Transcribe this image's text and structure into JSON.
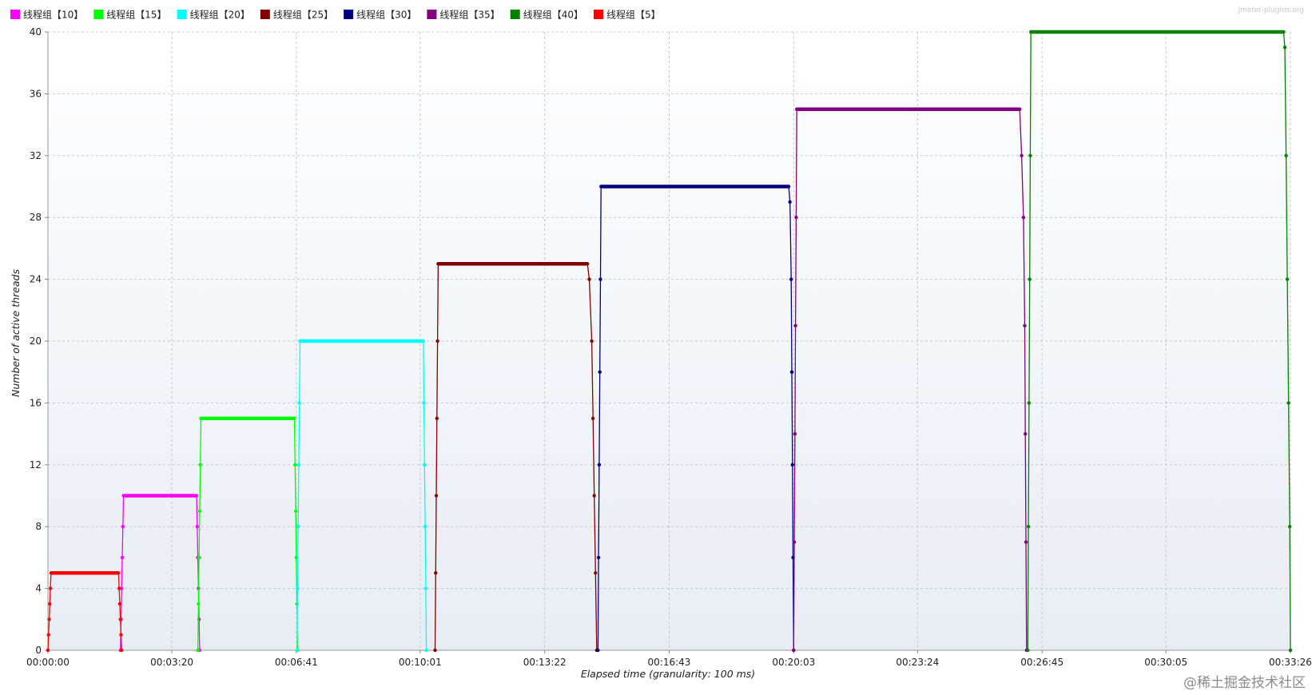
{
  "brand_text": "jmeter-plugins.org",
  "watermark": "@稀土掘金技术社区",
  "chart_data": {
    "type": "line",
    "title": "",
    "xlabel": "Elapsed time (granularity: 100 ms)",
    "ylabel": "Number of active threads",
    "x_unit": "seconds",
    "xlim": [
      0,
      2006
    ],
    "ylim": [
      0,
      40
    ],
    "grid": true,
    "legend_position": "top-left",
    "y_ticks": [
      0,
      4,
      8,
      12,
      16,
      20,
      24,
      28,
      32,
      36,
      40
    ],
    "x_ticks": [
      0,
      200,
      401,
      601,
      802,
      1003,
      1204,
      1404,
      1605,
      1805,
      2006
    ],
    "x_tick_labels": [
      "00:00:00",
      "00:03:20",
      "00:06:41",
      "00:10:01",
      "00:13:22",
      "00:16:43",
      "00:20:03",
      "00:23:24",
      "00:26:45",
      "00:30:05",
      "00:33:26"
    ],
    "series": [
      {
        "name": "线程组【10】",
        "color": "#ff00ff",
        "points": [
          [
            117,
            0
          ],
          [
            118,
            2
          ],
          [
            119,
            4
          ],
          [
            120,
            6
          ],
          [
            121,
            8
          ],
          [
            122,
            10
          ],
          [
            240,
            10
          ],
          [
            241,
            8
          ],
          [
            242,
            6
          ],
          [
            243,
            4
          ],
          [
            244,
            2
          ],
          [
            245,
            0
          ]
        ]
      },
      {
        "name": "线程组【15】",
        "color": "#00ff00",
        "points": [
          [
            242,
            0
          ],
          [
            243,
            3
          ],
          [
            244,
            6
          ],
          [
            245,
            9
          ],
          [
            246,
            12
          ],
          [
            247,
            15
          ],
          [
            398,
            15
          ],
          [
            399,
            12
          ],
          [
            400,
            9
          ],
          [
            401,
            6
          ],
          [
            402,
            3
          ],
          [
            403,
            0
          ]
        ]
      },
      {
        "name": "线程组【20】",
        "color": "#00ffff",
        "points": [
          [
            402,
            0
          ],
          [
            403,
            4
          ],
          [
            404,
            8
          ],
          [
            405,
            12
          ],
          [
            406,
            16
          ],
          [
            407,
            20
          ],
          [
            606,
            20
          ],
          [
            607,
            16
          ],
          [
            608,
            12
          ],
          [
            609,
            8
          ],
          [
            610,
            4
          ],
          [
            611,
            0
          ]
        ]
      },
      {
        "name": "线程组【25】",
        "color": "#800000",
        "points": [
          [
            625,
            0
          ],
          [
            626,
            5
          ],
          [
            627,
            10
          ],
          [
            628,
            15
          ],
          [
            629,
            20
          ],
          [
            630,
            25
          ],
          [
            871,
            25
          ],
          [
            874,
            24
          ],
          [
            878,
            20
          ],
          [
            880,
            15
          ],
          [
            882,
            10
          ],
          [
            884,
            5
          ],
          [
            886,
            0
          ]
        ]
      },
      {
        "name": "线程组【30】",
        "color": "#000080",
        "points": [
          [
            888,
            0
          ],
          [
            889,
            6
          ],
          [
            890,
            12
          ],
          [
            891,
            18
          ],
          [
            892,
            24
          ],
          [
            893,
            30
          ],
          [
            1196,
            30
          ],
          [
            1198,
            29
          ],
          [
            1200,
            24
          ],
          [
            1201,
            18
          ],
          [
            1202,
            12
          ],
          [
            1203,
            6
          ],
          [
            1204,
            0
          ]
        ]
      },
      {
        "name": "线程组【35】",
        "color": "#800080",
        "points": [
          [
            1204,
            0
          ],
          [
            1205,
            7
          ],
          [
            1206,
            14
          ],
          [
            1207,
            21
          ],
          [
            1208,
            28
          ],
          [
            1209,
            35
          ],
          [
            1569,
            35
          ],
          [
            1572,
            32
          ],
          [
            1575,
            28
          ],
          [
            1577,
            21
          ],
          [
            1578,
            14
          ],
          [
            1579,
            7
          ],
          [
            1580,
            0
          ]
        ]
      },
      {
        "name": "线程组【40】",
        "color": "#008000",
        "points": [
          [
            1582,
            0
          ],
          [
            1583,
            8
          ],
          [
            1584,
            16
          ],
          [
            1585,
            24
          ],
          [
            1586,
            32
          ],
          [
            1587,
            40
          ],
          [
            1995,
            40
          ],
          [
            1997,
            39
          ],
          [
            1999,
            32
          ],
          [
            2001,
            24
          ],
          [
            2003,
            16
          ],
          [
            2005,
            8
          ],
          [
            2006,
            0
          ]
        ]
      },
      {
        "name": "线程组【5】",
        "color": "#ff0000",
        "points": [
          [
            0,
            0
          ],
          [
            1,
            1
          ],
          [
            2,
            2
          ],
          [
            3,
            3
          ],
          [
            4,
            4
          ],
          [
            5,
            5
          ],
          [
            114,
            5
          ],
          [
            115,
            4
          ],
          [
            116,
            3
          ],
          [
            117,
            2
          ],
          [
            118,
            1
          ],
          [
            119,
            0
          ]
        ]
      }
    ]
  }
}
